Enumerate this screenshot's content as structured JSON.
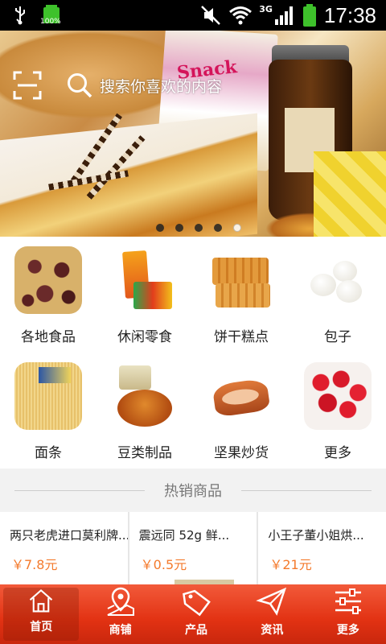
{
  "status_bar": {
    "battery_left_label": "100%",
    "network": "3G",
    "time": "17:38"
  },
  "search": {
    "placeholder": "搜索你喜欢的内容"
  },
  "banner": {
    "box_text": "Snack",
    "slide_count": 5,
    "active_slide": 5
  },
  "categories": [
    {
      "label": "各地食品",
      "icon": "regional-food-image"
    },
    {
      "label": "休闲零食",
      "icon": "snacks-image"
    },
    {
      "label": "饼干糕点",
      "icon": "biscuits-image"
    },
    {
      "label": "包子",
      "icon": "buns-image"
    },
    {
      "label": "面条",
      "icon": "noodles-image"
    },
    {
      "label": "豆类制品",
      "icon": "bean-products-image"
    },
    {
      "label": "坚果炒货",
      "icon": "nuts-image"
    },
    {
      "label": "更多",
      "icon": "more-image"
    }
  ],
  "hot": {
    "title": "热销商品"
  },
  "products": [
    {
      "name": "两只老虎进口莫利牌...",
      "price": "￥7.8元"
    },
    {
      "name": "震远同 52g 鲜...",
      "price": "￥0.5元"
    },
    {
      "name": "小王子董小姐烘...",
      "price": "￥21元"
    }
  ],
  "tabs": [
    {
      "label": "首页",
      "icon": "home-icon",
      "active": true
    },
    {
      "label": "商铺",
      "icon": "map-pin-icon",
      "active": false
    },
    {
      "label": "产品",
      "icon": "sale-tag-icon",
      "active": false
    },
    {
      "label": "资讯",
      "icon": "paper-plane-icon",
      "active": false
    },
    {
      "label": "更多",
      "icon": "sliders-icon",
      "active": false
    }
  ],
  "colors": {
    "tab_bar": "#e23213",
    "price": "#f47a2c",
    "status_bar": "#000000",
    "battery": "#3ec12b"
  }
}
